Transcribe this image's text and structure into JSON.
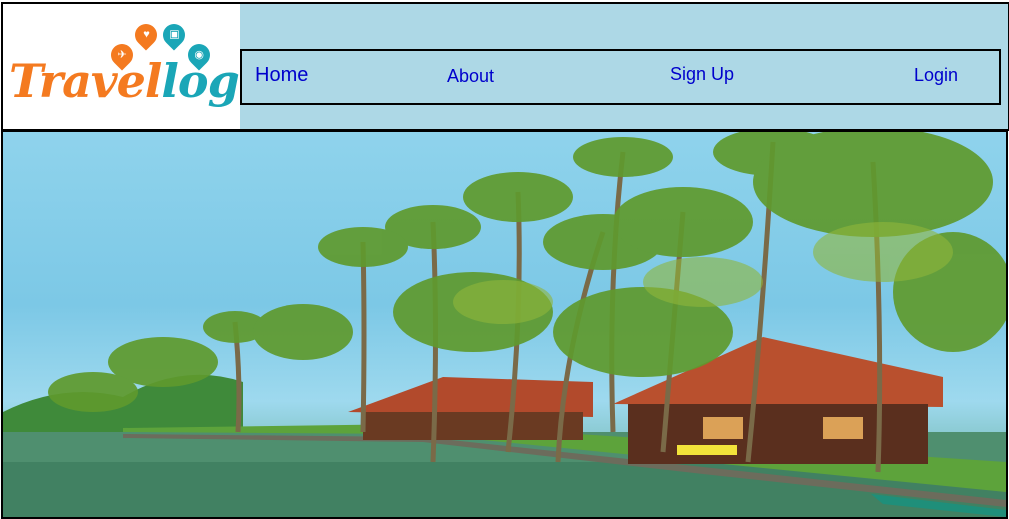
{
  "brand": {
    "name_part1": "Travel",
    "name_part2": "log",
    "pin_icons": [
      {
        "icon": "plane-icon",
        "color": "#f47a20",
        "glyph": "✈"
      },
      {
        "icon": "heart-icon",
        "color": "#f47a20",
        "glyph": "♥"
      },
      {
        "icon": "luggage-icon",
        "color": "#1aa6b7",
        "glyph": "▣"
      },
      {
        "icon": "camera-icon",
        "color": "#1aa6b7",
        "glyph": "◉"
      }
    ]
  },
  "nav": {
    "home": "Home",
    "about": "About",
    "signup": "Sign Up",
    "login": "Login"
  },
  "colors": {
    "header_bg": "#add8e6",
    "link": "#0000cc",
    "brand_orange": "#f47a20",
    "brand_teal": "#1aa6b7"
  },
  "hero": {
    "image_subject": "tropical backwater resort with palm trees"
  }
}
